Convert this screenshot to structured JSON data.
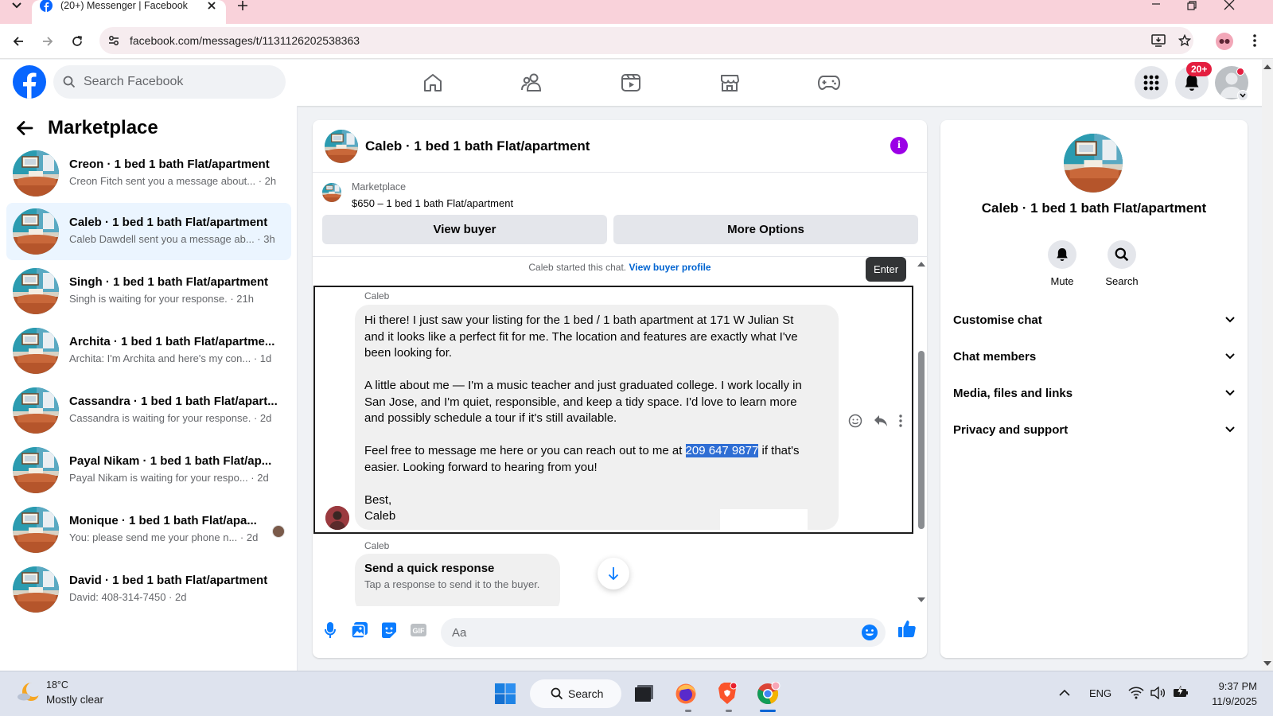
{
  "browser": {
    "tab_title": "(20+) Messenger | Facebook",
    "url": "facebook.com/messages/t/1131126202538363"
  },
  "header": {
    "search_placeholder": "Search Facebook",
    "notif_badge": "20+",
    "nav_icons": [
      "home-icon",
      "friends-icon",
      "video-icon",
      "marketplace-icon",
      "gaming-icon"
    ],
    "brand_color": "#0866ff"
  },
  "sidebar": {
    "title": "Marketplace",
    "conversations": [
      {
        "title": "Creon · 1 bed 1 bath Flat/apartment",
        "snippet": "Creon Fitch sent you a message about... · 2h"
      },
      {
        "title": "Caleb · 1 bed 1 bath Flat/apartment",
        "snippet": "Caleb Dawdell sent you a message ab... · 3h"
      },
      {
        "title": "Singh · 1 bed 1 bath Flat/apartment",
        "snippet": "Singh is waiting for your response. · 21h"
      },
      {
        "title": "Archita · 1 bed 1 bath Flat/apartme...",
        "snippet": "Archita: I'm Archita and here's my con... · 1d"
      },
      {
        "title": "Cassandra · 1 bed 1 bath Flat/apart...",
        "snippet": "Cassandra is waiting for your response. · 2d"
      },
      {
        "title": "Payal Nikam · 1 bed 1 bath Flat/ap...",
        "snippet": "Payal Nikam is waiting for your respo... · 2d"
      },
      {
        "title": "Monique · 1 bed 1 bath Flat/apa...",
        "snippet": "You: please send me your phone n... · 2d"
      },
      {
        "title": "David · 1 bed 1 bath Flat/apartment",
        "snippet": "David: 408-314-7450 · 2d"
      }
    ]
  },
  "chat": {
    "title": "Caleb · 1 bed 1 bath Flat/apartment",
    "listing_source": "Marketplace",
    "listing_name": "$650 – 1 bed 1 bath Flat/apartment",
    "view_buyer": "View buyer",
    "more_options": "More Options",
    "started_text": "Caleb started this chat.",
    "view_buyer_profile": "View buyer profile",
    "tooltip": "Enter",
    "sender": "Caleb",
    "message": {
      "p1_l1": "Hi there! I just saw your listing for the 1 bed / 1 bath apartment at 171 W Julian St",
      "p1_l2": "and it looks like a perfect fit for me. The location and features are exactly what I've",
      "p1_l3": "been looking for.",
      "p2_l1": "A little about me — I'm a music teacher and just graduated college. I work locally in",
      "p2_l2": "San Jose, and I'm quiet, responsible, and keep a tidy space. I'd love to learn more",
      "p2_l3": "and possibly schedule a tour if it's still available.",
      "p3_pre": "Feel free to message me here or you can reach out to me at ",
      "p3_phone": "209 647 9877",
      "p3_post": " if that's",
      "p3_l2": "easier. Looking forward to hearing from you!",
      "sign1": "Best,",
      "sign2": "Caleb"
    },
    "quick_sender": "Caleb",
    "quick_title": "Send a quick response",
    "quick_sub": "Tap a response to send it to the buyer.",
    "composer_placeholder": "Aa"
  },
  "rightpanel": {
    "title": "Caleb · 1 bed 1 bath Flat/apartment",
    "mute": "Mute",
    "search": "Search",
    "sections": [
      "Customise chat",
      "Chat members",
      "Media, files and links",
      "Privacy and support"
    ]
  },
  "taskbar": {
    "temp": "18°C",
    "weather": "Mostly clear",
    "search": "Search",
    "lang": "ENG",
    "time": "9:37 PM",
    "date": "11/9/2025"
  }
}
